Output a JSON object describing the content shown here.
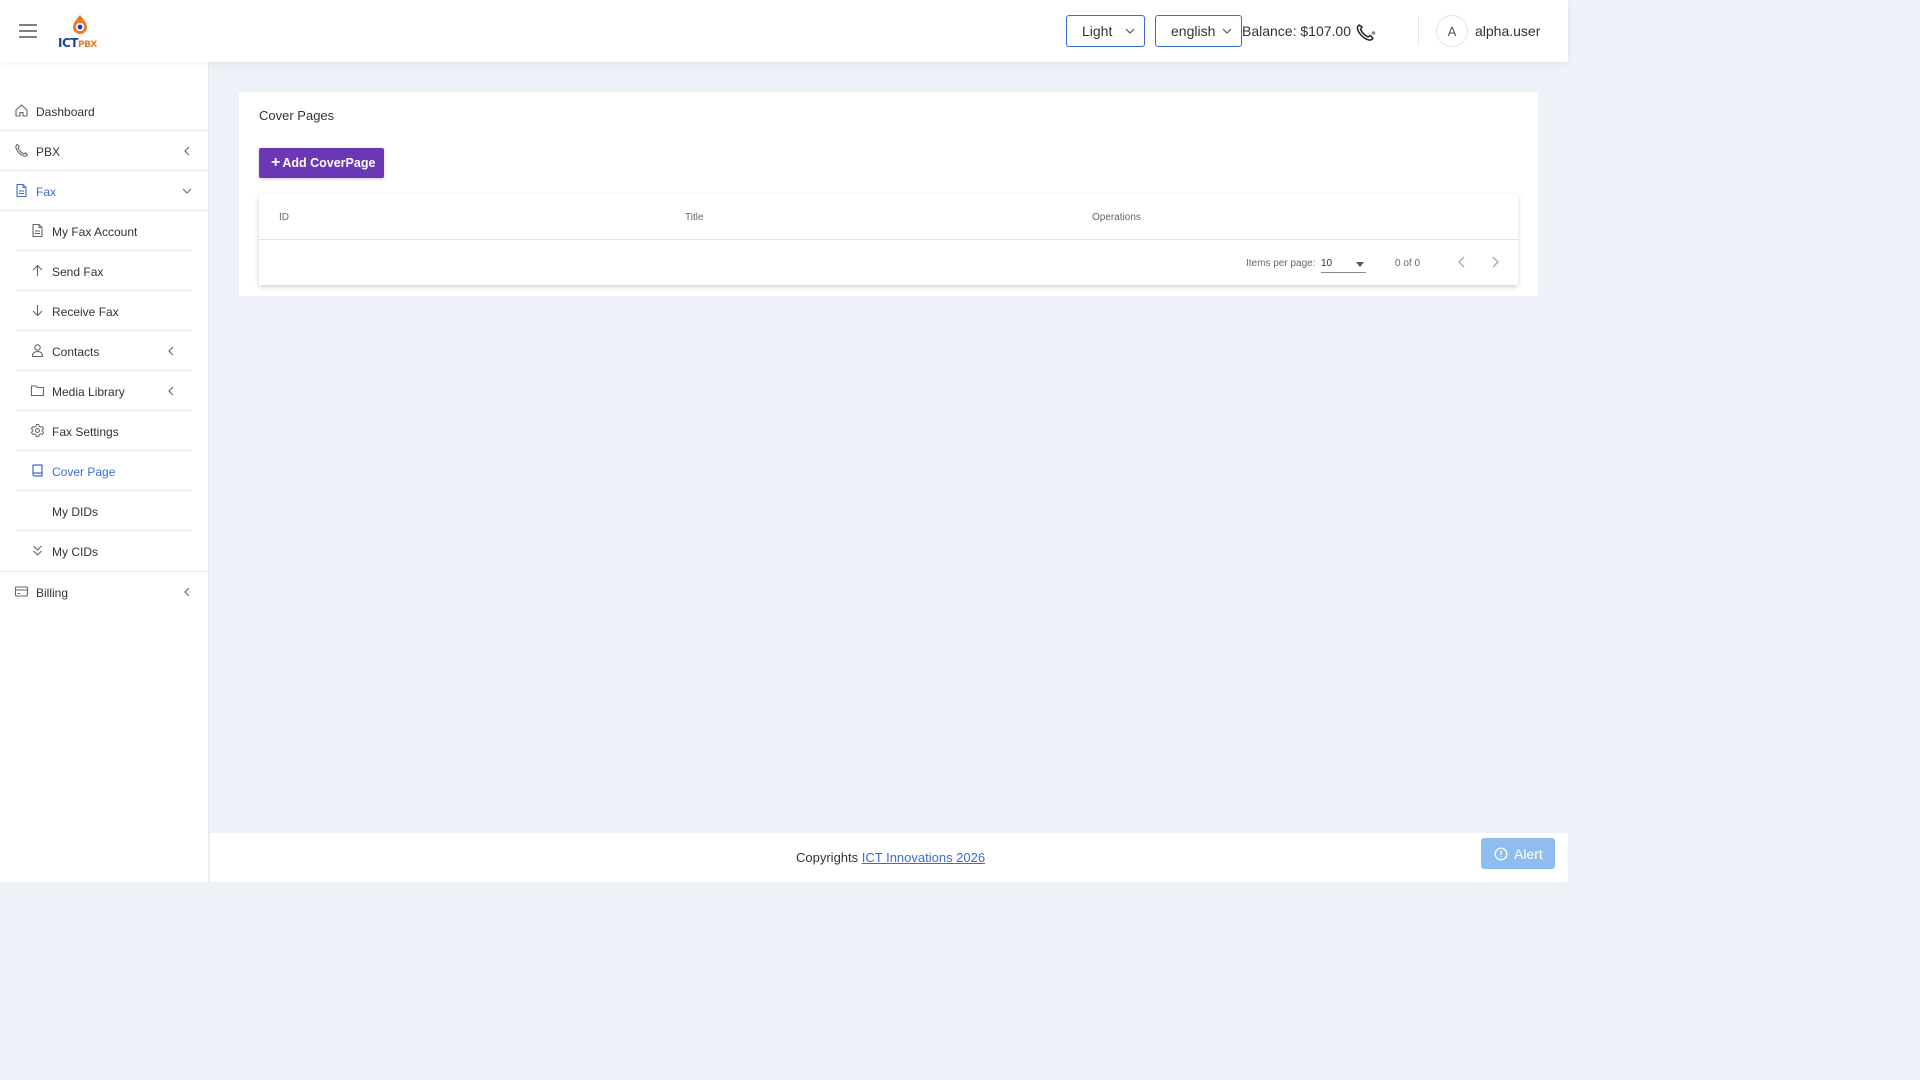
{
  "header": {
    "logo_text": "ICT",
    "logo_sub": "PBX",
    "theme": "Light",
    "language": "english",
    "balance": "Balance: $107.00",
    "avatar_initial": "A",
    "username": "alpha.user"
  },
  "sidebar": {
    "items": [
      {
        "label": "Dashboard",
        "icon": "home-icon"
      },
      {
        "label": "PBX",
        "icon": "phone-icon"
      },
      {
        "label": "Fax",
        "icon": "document-icon"
      },
      {
        "label": "Billing",
        "icon": "billing-icon"
      }
    ],
    "fax_items": [
      {
        "label": "My Fax Account",
        "icon": "document-icon"
      },
      {
        "label": "Send Fax",
        "icon": "arrow-up-icon"
      },
      {
        "label": "Receive Fax",
        "icon": "arrow-down-icon"
      },
      {
        "label": "Contacts",
        "icon": "person-icon"
      },
      {
        "label": "Media Library",
        "icon": "folder-icon"
      },
      {
        "label": "Fax Settings",
        "icon": "gear-icon"
      },
      {
        "label": "Cover Page",
        "icon": "book-icon"
      },
      {
        "label": "My DIDs",
        "icon": ""
      },
      {
        "label": "My CIDs",
        "icon": "double-chevron-down-icon"
      }
    ]
  },
  "main": {
    "title": "Cover Pages",
    "add_button": "Add CoverPage",
    "table": {
      "columns": [
        "ID",
        "Title",
        "Operations"
      ]
    },
    "paginator": {
      "items_per_page_label": "Items per page:",
      "items_per_page": "10",
      "range": "0 of 0"
    }
  },
  "footer": {
    "text": "Copyrights",
    "link": "ICT Innovations 2026"
  },
  "alert_label": "Alert",
  "colors": {
    "accent": "#3b6ad8",
    "add_button": "#6a38b5",
    "alert": "#8fbdf0",
    "background": "#eef1f7"
  }
}
